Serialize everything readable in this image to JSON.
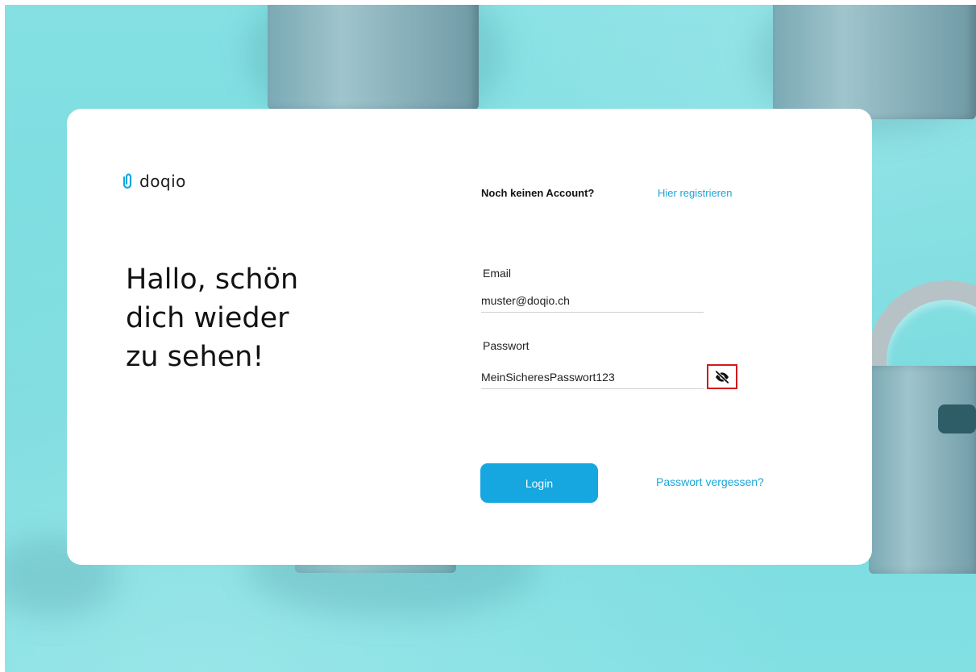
{
  "brand": {
    "name": "doqio",
    "accent_color": "#16a6e0"
  },
  "greeting": {
    "lines": [
      "Hallo, schön",
      "dich wieder",
      "zu sehen!"
    ]
  },
  "signup": {
    "prompt": "Noch keinen Account?",
    "link_label": "Hier registrieren"
  },
  "form": {
    "email": {
      "label": "Email",
      "value": "muster@doqio.ch"
    },
    "password": {
      "label": "Passwort",
      "value": "MeinSicheresPasswort123",
      "visibility_icon": "eye-slash-icon"
    },
    "login_label": "Login",
    "forgot_label": "Passwort vergessen?"
  }
}
